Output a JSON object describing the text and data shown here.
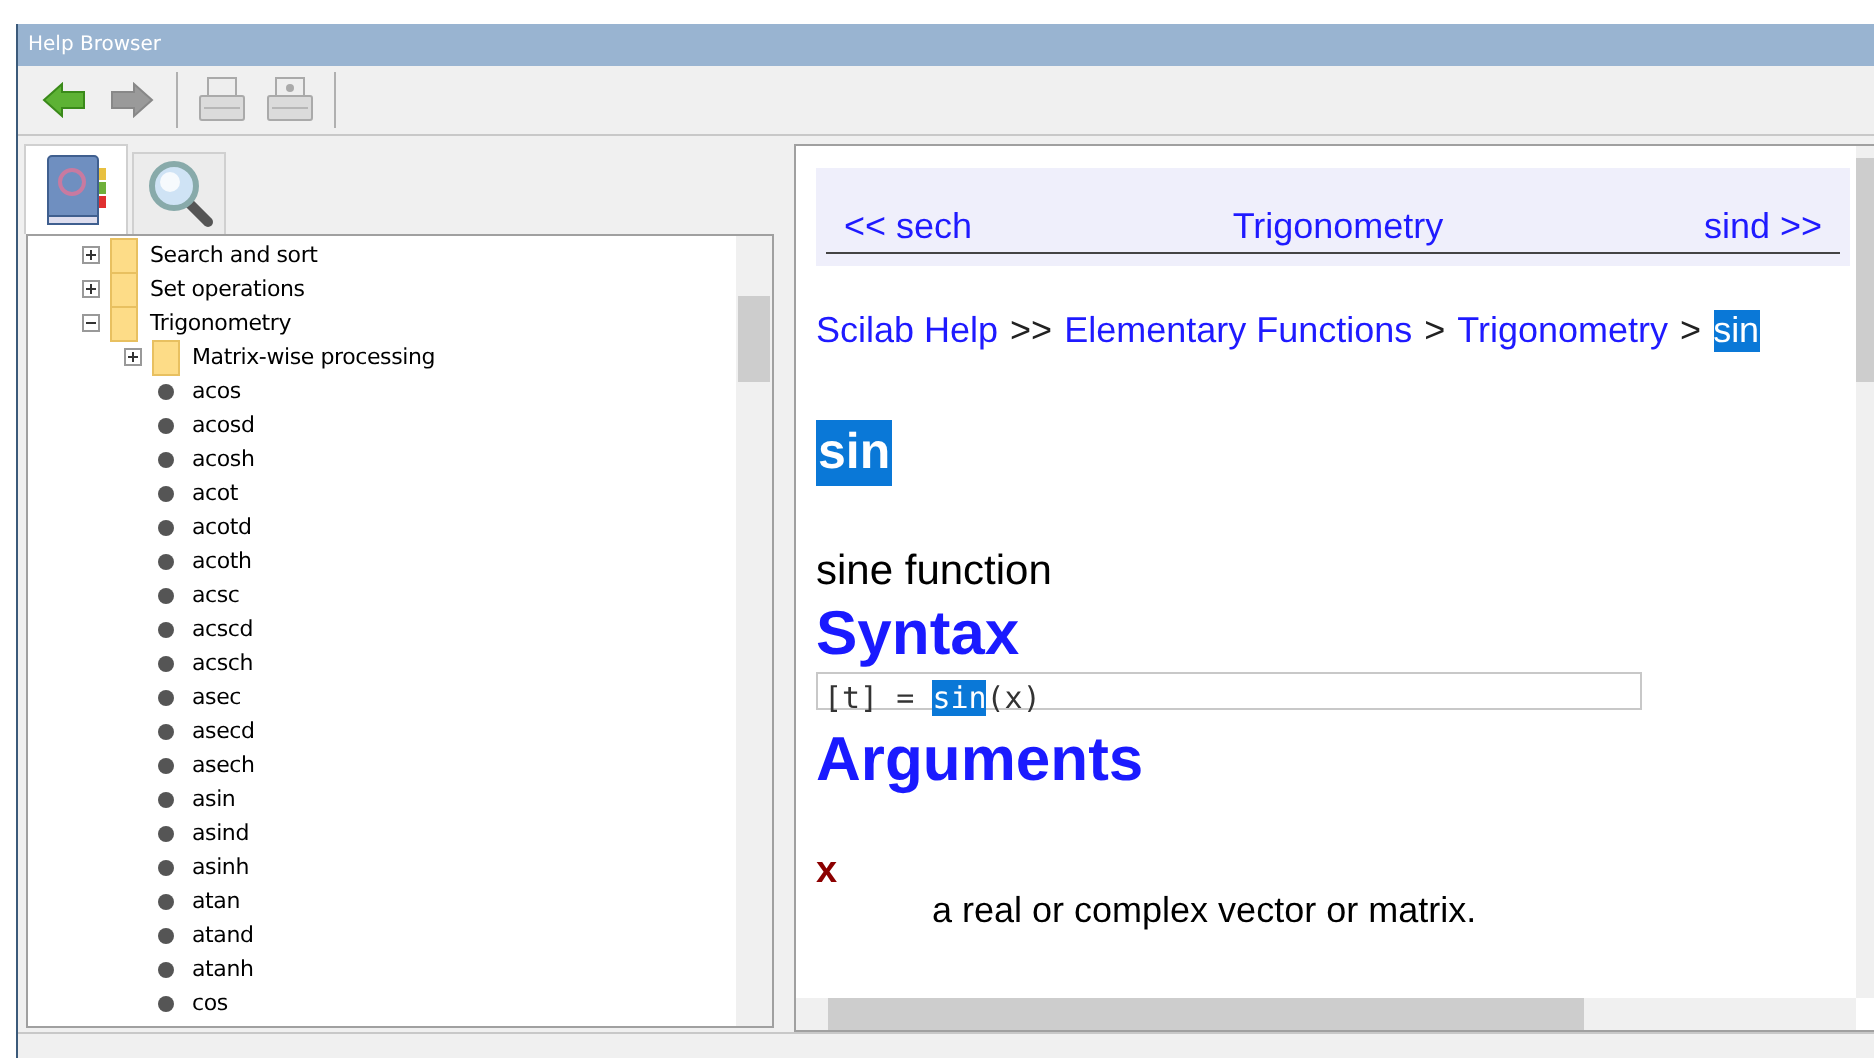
{
  "window": {
    "title": "Help Browser"
  },
  "toolbar": [
    {
      "kind": "back",
      "disabled": false
    },
    {
      "kind": "forward",
      "disabled": true
    },
    {
      "kind": "print",
      "disabled": true
    },
    {
      "kind": "preview",
      "disabled": true
    }
  ],
  "tabs": [
    {
      "kind": "contents",
      "selected": true
    },
    {
      "kind": "search",
      "selected": false
    }
  ],
  "tree": [
    {
      "label": "Search and sort",
      "kind": "folder",
      "expanded": false
    },
    {
      "label": "Set operations",
      "kind": "folder",
      "expanded": false
    },
    {
      "label": "Trigonometry",
      "kind": "folder",
      "expanded": true,
      "children": [
        {
          "label": "Matrix-wise processing",
          "kind": "folder",
          "expanded": false
        },
        {
          "label": "acos",
          "kind": "page"
        },
        {
          "label": "acosd",
          "kind": "page"
        },
        {
          "label": "acosh",
          "kind": "page"
        },
        {
          "label": "acot",
          "kind": "page"
        },
        {
          "label": "acotd",
          "kind": "page"
        },
        {
          "label": "acoth",
          "kind": "page"
        },
        {
          "label": "acsc",
          "kind": "page"
        },
        {
          "label": "acscd",
          "kind": "page"
        },
        {
          "label": "acsch",
          "kind": "page"
        },
        {
          "label": "asec",
          "kind": "page"
        },
        {
          "label": "asecd",
          "kind": "page"
        },
        {
          "label": "asech",
          "kind": "page"
        },
        {
          "label": "asin",
          "kind": "page"
        },
        {
          "label": "asind",
          "kind": "page"
        },
        {
          "label": "asinh",
          "kind": "page"
        },
        {
          "label": "atan",
          "kind": "page"
        },
        {
          "label": "atand",
          "kind": "page"
        },
        {
          "label": "atanh",
          "kind": "page"
        },
        {
          "label": "cos",
          "kind": "page"
        }
      ]
    }
  ],
  "page": {
    "nav": {
      "prev": "<< sech",
      "up": "Trigonometry",
      "next": "sind >>"
    },
    "breadcrumb": [
      {
        "text": "Scilab Help",
        "kind": "link",
        "highlighted": false
      },
      {
        "text": ">>",
        "kind": "separator",
        "highlighted": false
      },
      {
        "text": "Elementary Functions",
        "kind": "link",
        "highlighted": false
      },
      {
        "text": ">",
        "kind": "separator",
        "highlighted": false
      },
      {
        "text": "Trigonometry",
        "kind": "link",
        "highlighted": false
      },
      {
        "text": ">",
        "kind": "separator",
        "highlighted": false
      },
      {
        "text": "sin",
        "kind": "link",
        "highlighted": true
      }
    ],
    "title": {
      "text": "sin",
      "highlighted": true
    },
    "summary": "sine function",
    "syntax_heading": "Syntax",
    "syntax": [
      {
        "text": "[t] = ",
        "highlighted": false
      },
      {
        "text": "sin",
        "highlighted": true
      },
      {
        "text": "(x)",
        "highlighted": false
      }
    ],
    "arguments_heading": "Arguments",
    "arguments": [
      {
        "name": "x",
        "description": "a real or complex vector or matrix."
      }
    ]
  }
}
